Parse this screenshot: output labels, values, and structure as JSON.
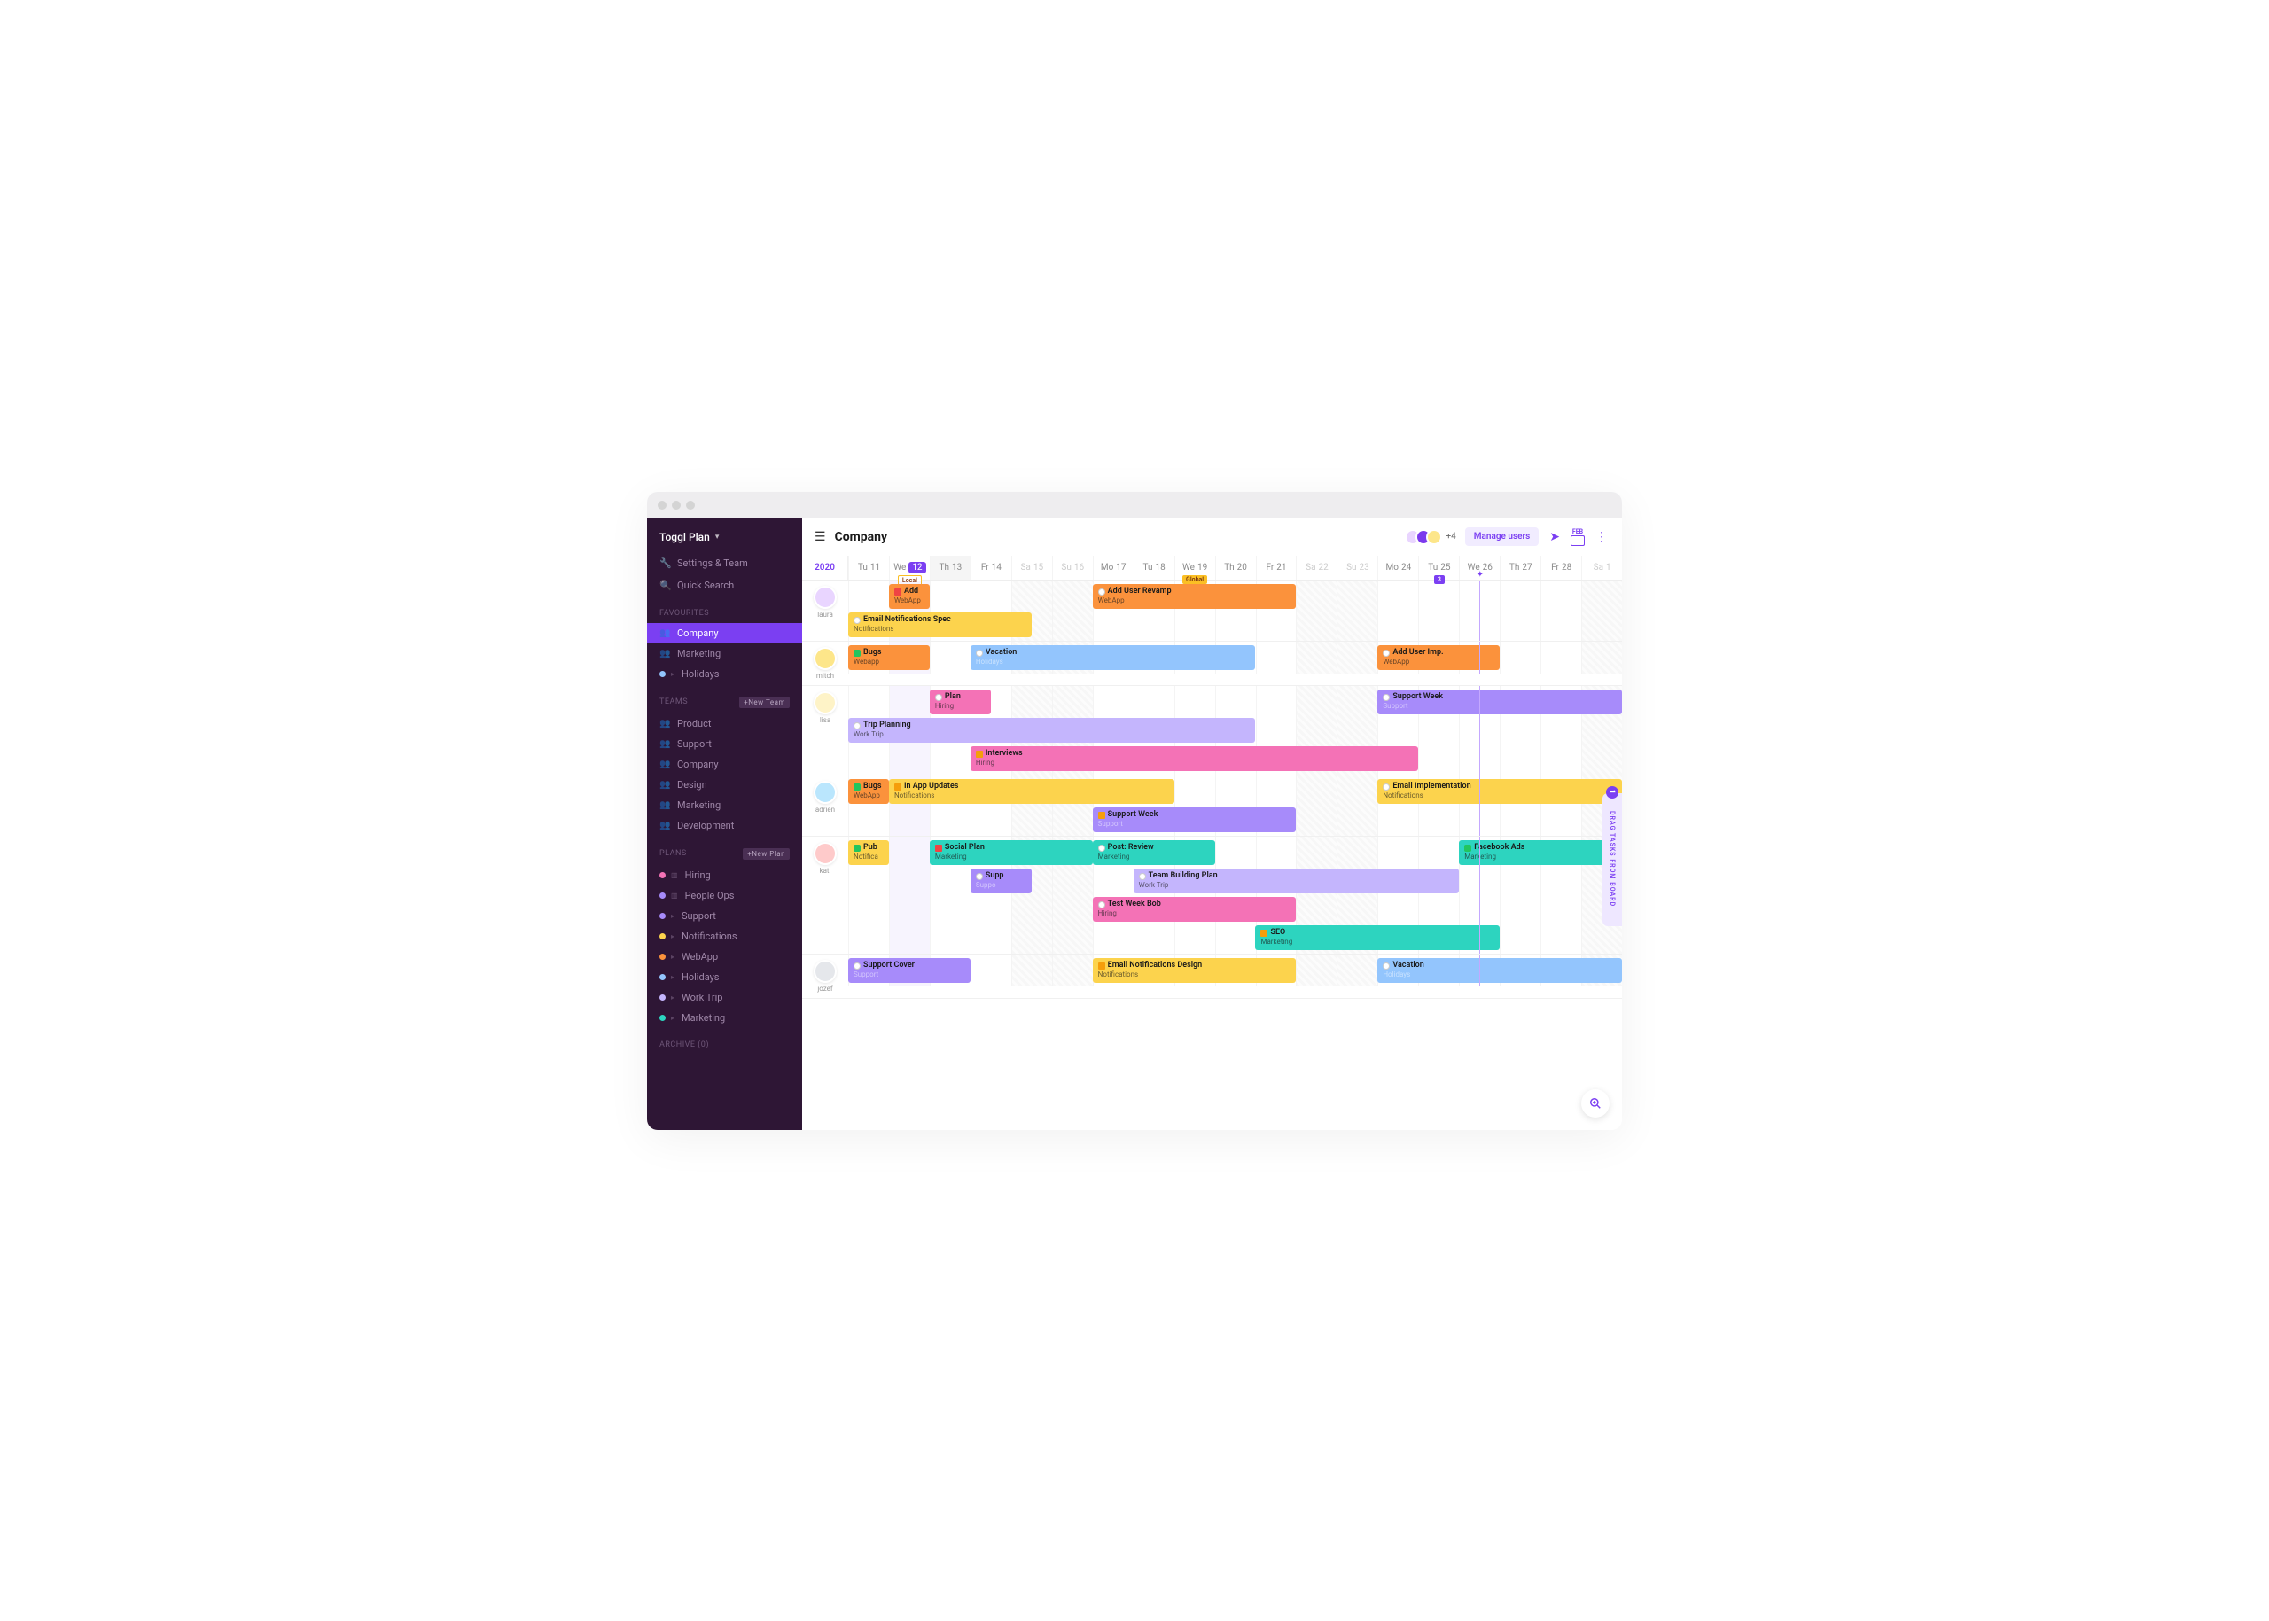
{
  "brand": "Toggl Plan",
  "sidebar": {
    "settings": "Settings & Team",
    "search": "Quick Search",
    "favourites_label": "FAVOURITES",
    "favourites": [
      {
        "label": "Company",
        "type": "team",
        "active": true
      },
      {
        "label": "Marketing",
        "type": "team"
      },
      {
        "label": "Holidays",
        "type": "plan",
        "color": "#93c5fd",
        "expandable": true
      }
    ],
    "teams_label": "TEAMS",
    "new_team": "+New Team",
    "teams": [
      {
        "label": "Product"
      },
      {
        "label": "Support"
      },
      {
        "label": "Company"
      },
      {
        "label": "Design"
      },
      {
        "label": "Marketing"
      },
      {
        "label": "Development"
      }
    ],
    "plans_label": "PLANS",
    "new_plan": "+New Plan",
    "plans": [
      {
        "label": "Hiring",
        "color": "#f472b6",
        "board": true
      },
      {
        "label": "People Ops",
        "color": "#a78bfa",
        "board": true
      },
      {
        "label": "Support",
        "color": "#a78bfa",
        "expandable": true
      },
      {
        "label": "Notifications",
        "color": "#fcd34d",
        "expandable": true
      },
      {
        "label": "WebApp",
        "color": "#fb923c",
        "expandable": true
      },
      {
        "label": "Holidays",
        "color": "#93c5fd",
        "expandable": true
      },
      {
        "label": "Work Trip",
        "color": "#c4b5fd",
        "expandable": true
      },
      {
        "label": "Marketing",
        "color": "#2dd4bf",
        "expandable": true
      }
    ],
    "archive_label": "ARCHIVE (0)"
  },
  "header": {
    "title": "Company",
    "plus_count": "+4",
    "manage": "Manage users",
    "month_badge": "FEB"
  },
  "timeline": {
    "year": "2020",
    "days": [
      {
        "dow": "Tu",
        "num": "11"
      },
      {
        "dow": "We",
        "num": "12",
        "today": true,
        "tag": "Local",
        "tag_class": "tag-local"
      },
      {
        "dow": "Th",
        "num": "13",
        "selected": true
      },
      {
        "dow": "Fr",
        "num": "14"
      },
      {
        "dow": "Sa",
        "num": "15",
        "weekend": true
      },
      {
        "dow": "Su",
        "num": "16",
        "weekend": true
      },
      {
        "dow": "Mo",
        "num": "17"
      },
      {
        "dow": "Tu",
        "num": "18"
      },
      {
        "dow": "We",
        "num": "19",
        "tag": "Global",
        "tag_class": "tag-global"
      },
      {
        "dow": "Th",
        "num": "20"
      },
      {
        "dow": "Fr",
        "num": "21"
      },
      {
        "dow": "Sa",
        "num": "22",
        "weekend": true
      },
      {
        "dow": "Su",
        "num": "23",
        "weekend": true
      },
      {
        "dow": "Mo",
        "num": "24"
      },
      {
        "dow": "Tu",
        "num": "25",
        "tag": "3",
        "tag_class": "tag-blue"
      },
      {
        "dow": "We",
        "num": "26",
        "milestone": true
      },
      {
        "dow": "Th",
        "num": "27"
      },
      {
        "dow": "Fr",
        "num": "28"
      },
      {
        "dow": "Sa",
        "num": "1",
        "weekend": true
      }
    ]
  },
  "people": [
    {
      "name": "laura",
      "avatar_bg": "#e9d5ff",
      "lanes": [
        [
          {
            "title": "Add",
            "sub": "WebApp",
            "color": "#fb923c",
            "status": "blocked",
            "start": 1,
            "span": 1
          },
          {
            "title": "Add User Revamp",
            "sub": "WebApp",
            "color": "#fb923c",
            "status": "blank",
            "start": 6,
            "span": 5
          }
        ],
        [
          {
            "title": "Email Notifications Spec",
            "sub": "Notifications",
            "color": "#fcd34d",
            "status": "blank",
            "start": 0,
            "span": 4.5
          }
        ]
      ]
    },
    {
      "name": "mitch",
      "avatar_bg": "#fde68a",
      "lanes": [
        [
          {
            "title": "Bugs",
            "sub": "Webapp",
            "color": "#fb923c",
            "status": "done",
            "start": 0,
            "span": 2
          },
          {
            "title": "Vacation",
            "sub": "Holidays",
            "color": "#93c5fd",
            "status": "blank",
            "start": 3,
            "span": 7,
            "light_text": true
          },
          {
            "title": "Add User Imp.",
            "sub": "WebApp",
            "color": "#fb923c",
            "status": "blank",
            "start": 13,
            "span": 3
          }
        ]
      ]
    },
    {
      "name": "lisa",
      "avatar_bg": "#fef3c7",
      "lanes": [
        [
          {
            "title": "Plan",
            "sub": "Hiring",
            "color": "#f472b6",
            "status": "blank",
            "start": 2,
            "span": 1.5
          },
          {
            "title": "Support Week",
            "sub": "Support",
            "color": "#a78bfa",
            "status": "blank",
            "start": 13,
            "span": 6,
            "light_text": true
          }
        ],
        [
          {
            "title": "Trip Planning",
            "sub": "Work Trip",
            "color": "#c4b5fd",
            "status": "blank",
            "start": 0,
            "span": 10
          }
        ],
        [
          {
            "title": "Interviews",
            "sub": "Hiring",
            "color": "#f472b6",
            "status": "progress",
            "start": 3,
            "span": 11
          }
        ]
      ]
    },
    {
      "name": "adrien",
      "avatar_bg": "#bae6fd",
      "lanes": [
        [
          {
            "title": "Bugs",
            "sub": "WebApp",
            "color": "#fb923c",
            "status": "done",
            "start": 0,
            "span": 1
          },
          {
            "title": "In App Updates",
            "sub": "Notifications",
            "color": "#fcd34d",
            "status": "progress",
            "start": 1,
            "span": 7
          },
          {
            "title": "Email Implementation",
            "sub": "Notifications",
            "color": "#fcd34d",
            "status": "blank",
            "start": 13,
            "span": 6
          }
        ],
        [
          {
            "title": "Support Week",
            "sub": "Support",
            "color": "#a78bfa",
            "status": "progress",
            "start": 6,
            "span": 5,
            "light_text": true
          }
        ]
      ]
    },
    {
      "name": "kati",
      "avatar_bg": "#fecaca",
      "lanes": [
        [
          {
            "title": "Pub",
            "sub": "Notifica",
            "color": "#fcd34d",
            "status": "done",
            "start": 0,
            "span": 1
          },
          {
            "title": "Social Plan",
            "sub": "Marketing",
            "color": "#2dd4bf",
            "status": "blocked",
            "start": 2,
            "span": 4
          },
          {
            "title": "Post: Review",
            "sub": "Marketing",
            "color": "#2dd4bf",
            "status": "blank",
            "start": 6,
            "span": 3
          },
          {
            "title": "Facebook Ads",
            "sub": "Marketing",
            "color": "#2dd4bf",
            "status": "done",
            "start": 15,
            "span": 4
          }
        ],
        [
          {
            "title": "Supp",
            "sub": "Suppo",
            "color": "#a78bfa",
            "status": "blank",
            "start": 3,
            "span": 1.5,
            "light_text": true
          },
          {
            "title": "Team Building Plan",
            "sub": "Work Trip",
            "color": "#c4b5fd",
            "status": "blank",
            "start": 7,
            "span": 8
          }
        ],
        [
          {
            "title": "Test Week Bob",
            "sub": "Hiring",
            "color": "#f472b6",
            "status": "blank",
            "start": 6,
            "span": 5
          }
        ],
        [
          {
            "title": "SEO",
            "sub": "Marketing",
            "color": "#2dd4bf",
            "status": "progress",
            "start": 10,
            "span": 6
          }
        ]
      ]
    },
    {
      "name": "jozef",
      "avatar_bg": "#e5e7eb",
      "lanes": [
        [
          {
            "title": "Support Cover",
            "sub": "Support",
            "color": "#a78bfa",
            "status": "blank",
            "start": 0,
            "span": 3,
            "light_text": true
          },
          {
            "title": "Email Notifications Design",
            "sub": "Notifications",
            "color": "#fcd34d",
            "status": "progress",
            "start": 6,
            "span": 5
          },
          {
            "title": "Vacation",
            "sub": "Holidays",
            "color": "#93c5fd",
            "status": "blank",
            "start": 13,
            "span": 6,
            "light_text": true
          }
        ]
      ]
    }
  ],
  "drag_panel": {
    "label": "DRAG TASKS FROM BOARD",
    "count": "1"
  }
}
